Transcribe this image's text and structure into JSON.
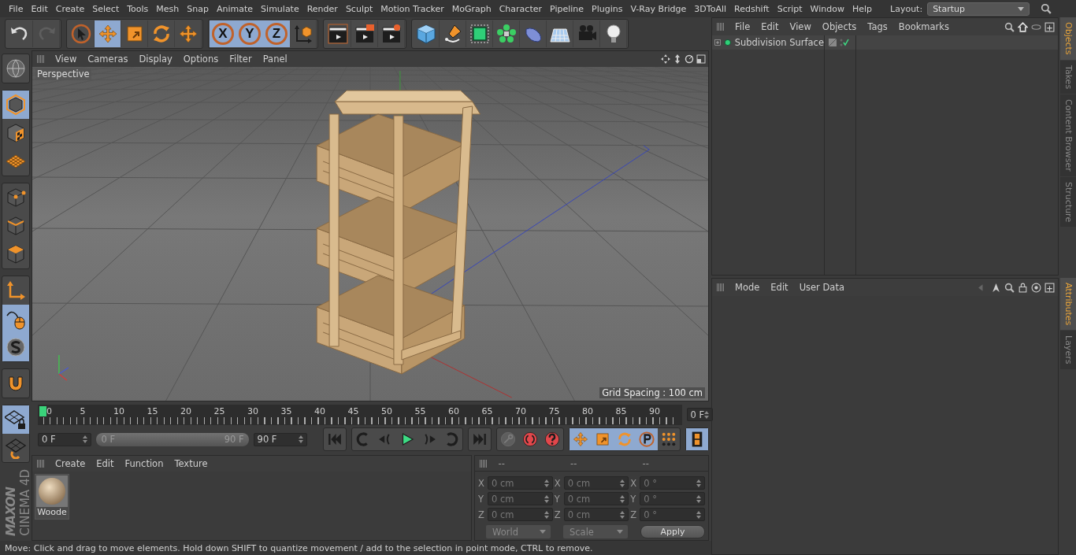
{
  "menu_bar": {
    "items": [
      "File",
      "Edit",
      "Create",
      "Select",
      "Tools",
      "Mesh",
      "Snap",
      "Animate",
      "Simulate",
      "Render",
      "Sculpt",
      "Motion Tracker",
      "MoGraph",
      "Character",
      "Pipeline",
      "Plugins",
      "V-Ray Bridge",
      "3DToAll",
      "Redshift",
      "Script",
      "Window",
      "Help"
    ],
    "layout_label": "Layout:",
    "layout_value": "Startup"
  },
  "toolbar": {
    "groups": [
      [
        {
          "kind": "undo",
          "selected": false,
          "disabled": false
        },
        {
          "kind": "redo",
          "selected": false,
          "disabled": true
        }
      ],
      [
        {
          "kind": "select",
          "selected": false,
          "disabled": false
        },
        {
          "kind": "move",
          "selected": true,
          "disabled": false
        },
        {
          "kind": "scale",
          "selected": false,
          "disabled": false
        },
        {
          "kind": "rotate",
          "selected": false,
          "disabled": false
        },
        {
          "kind": "move",
          "selected": false,
          "disabled": false
        }
      ],
      [
        {
          "kind": "axis",
          "label": "X",
          "selected": true,
          "disabled": false
        },
        {
          "kind": "axis",
          "label": "Y",
          "selected": true,
          "disabled": false
        },
        {
          "kind": "axis",
          "label": "Z",
          "selected": true,
          "disabled": false
        },
        {
          "kind": "coord",
          "selected": false,
          "disabled": false
        }
      ],
      [
        {
          "kind": "render-view",
          "selected": false,
          "disabled": false
        },
        {
          "kind": "render-picture",
          "selected": false,
          "disabled": false
        },
        {
          "kind": "render-settings",
          "selected": false,
          "disabled": false
        }
      ],
      [
        {
          "kind": "cube",
          "selected": false,
          "disabled": false
        },
        {
          "kind": "pen",
          "selected": false,
          "disabled": false
        },
        {
          "kind": "subdiv",
          "selected": false,
          "disabled": false
        },
        {
          "kind": "cloner",
          "selected": false,
          "disabled": false
        },
        {
          "kind": "bend",
          "selected": false,
          "disabled": false
        },
        {
          "kind": "floor",
          "selected": false,
          "disabled": false
        },
        {
          "kind": "camera",
          "selected": false,
          "disabled": false
        },
        {
          "kind": "light",
          "selected": false,
          "disabled": false
        }
      ]
    ]
  },
  "left_tools": {
    "groups": [
      [
        {
          "kind": "globe",
          "selected": false
        }
      ],
      [
        {
          "kind": "model",
          "selected": true
        },
        {
          "kind": "texture",
          "selected": false
        },
        {
          "kind": "workplane",
          "selected": false
        }
      ],
      [
        {
          "kind": "points",
          "selected": false
        },
        {
          "kind": "edges",
          "selected": false
        },
        {
          "kind": "polygons",
          "selected": false
        }
      ],
      [
        {
          "kind": "axis-mode",
          "selected": false
        },
        {
          "kind": "tweak",
          "selected": true
        },
        {
          "kind": "snap",
          "selected": true
        }
      ],
      [
        {
          "kind": "magnet",
          "selected": false
        }
      ],
      [
        {
          "kind": "grid-lock",
          "selected": true
        },
        {
          "kind": "grid-rotate",
          "selected": false
        }
      ]
    ]
  },
  "logo": {
    "brand": "MAXON",
    "product": "CINEMA 4D"
  },
  "viewport": {
    "menu": [
      "View",
      "Cameras",
      "Display",
      "Options",
      "Filter",
      "Panel"
    ],
    "camera_label": "Perspective",
    "grid_spacing": "Grid Spacing : 100 cm"
  },
  "timeline": {
    "ticks": [
      "0",
      "5",
      "10",
      "15",
      "20",
      "25",
      "30",
      "35",
      "40",
      "45",
      "50",
      "55",
      "60",
      "65",
      "70",
      "75",
      "80",
      "85",
      "90"
    ],
    "current_frame": "0 F"
  },
  "playback": {
    "start_field": "0 F",
    "range": {
      "start": "0 F",
      "end": "90 F",
      "level": 1
    },
    "end_field": "90 F",
    "groups": [
      [
        {
          "kind": "go-start",
          "selected": false,
          "disabled": false
        }
      ],
      [
        {
          "kind": "prev-key",
          "selected": false,
          "disabled": false
        },
        {
          "kind": "prev-frame",
          "selected": false,
          "disabled": false
        },
        {
          "kind": "play",
          "selected": false,
          "disabled": false
        },
        {
          "kind": "next-frame",
          "selected": false,
          "disabled": false
        },
        {
          "kind": "next-key",
          "selected": false,
          "disabled": false
        }
      ],
      [
        {
          "kind": "go-end",
          "selected": false,
          "disabled": false
        }
      ],
      [
        {
          "kind": "key",
          "selected": false,
          "disabled": true
        },
        {
          "kind": "autokey",
          "selected": false,
          "disabled": false
        },
        {
          "kind": "help",
          "selected": false,
          "disabled": false
        }
      ],
      [
        {
          "kind": "move",
          "selected": true,
          "disabled": false
        },
        {
          "kind": "scale",
          "selected": true,
          "disabled": false
        },
        {
          "kind": "rotate",
          "selected": true,
          "disabled": false
        },
        {
          "kind": "param",
          "selected": true,
          "disabled": false
        },
        {
          "kind": "dots",
          "selected": false,
          "disabled": false
        }
      ],
      [
        {
          "kind": "film",
          "selected": true,
          "disabled": false
        }
      ]
    ]
  },
  "material_manager": {
    "menu": [
      "Create",
      "Edit",
      "Function",
      "Texture"
    ],
    "materials": [
      {
        "name": "Woode"
      }
    ]
  },
  "coordinates": {
    "headers": [
      "--",
      "--",
      "--"
    ],
    "rows": [
      [
        {
          "axis": "X",
          "value": "0 cm"
        },
        {
          "axis": "X",
          "value": "0 cm"
        },
        {
          "axis": "X",
          "value": "0 °"
        }
      ],
      [
        {
          "axis": "Y",
          "value": "0 cm"
        },
        {
          "axis": "Y",
          "value": "0 cm"
        },
        {
          "axis": "Y",
          "value": "0 °"
        }
      ],
      [
        {
          "axis": "Z",
          "value": "0 cm"
        },
        {
          "axis": "Z",
          "value": "0 cm"
        },
        {
          "axis": "Z",
          "value": "0 °"
        }
      ]
    ],
    "dropdowns": [
      "World",
      "Scale"
    ],
    "apply": "Apply"
  },
  "status_bar": "Move: Click and drag to move elements. Hold down SHIFT to quantize movement / add to the selection in point mode, CTRL to remove.",
  "objects": {
    "menu": [
      "File",
      "Edit",
      "View",
      "Objects",
      "Tags",
      "Bookmarks"
    ],
    "tree": [
      {
        "name": "Subdivision Surface",
        "expanded": false,
        "enabled": true
      }
    ]
  },
  "attributes": {
    "menu": [
      "Mode",
      "Edit",
      "User Data"
    ]
  },
  "side_tabs": {
    "top": [
      {
        "label": "Objects",
        "selected": true
      },
      {
        "label": "Takes",
        "selected": false
      },
      {
        "label": "Content Browser",
        "selected": false
      },
      {
        "label": "Structure",
        "selected": false
      }
    ],
    "bottom": [
      {
        "label": "Attributes",
        "selected": true
      },
      {
        "label": "Layers",
        "selected": false
      }
    ]
  }
}
